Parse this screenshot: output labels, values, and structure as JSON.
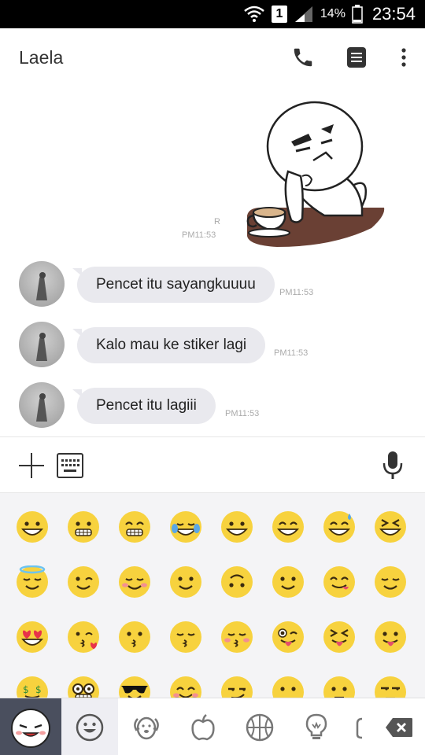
{
  "status_bar": {
    "sim_label": "1",
    "battery_text": "14%",
    "time": "23:54"
  },
  "header": {
    "contact_name": "Laela",
    "icons": [
      "phone-icon",
      "notes-icon",
      "more-vert-icon"
    ]
  },
  "chat": {
    "sent_sticker": {
      "read_mark": "R",
      "time": "PM11:53"
    },
    "messages": [
      {
        "text": "Pencet itu sayangkuuuu",
        "time": "PM11:53"
      },
      {
        "text": "Kalo mau ke stiker lagi",
        "time": "PM11:53"
      },
      {
        "text": "Pencet itu lagiii",
        "time": "PM11:53"
      }
    ]
  },
  "input_bar": {
    "icons": [
      "plus-icon",
      "keyboard-icon",
      "microphone-icon"
    ]
  },
  "emoji_panel": {
    "emoji_names": [
      "grinning-face",
      "grimacing-face",
      "beaming-face",
      "tears-of-joy-face",
      "smiling-face",
      "grinning-smiling-eyes-face",
      "sweat-smile-face",
      "squinting-laugh-face",
      "halo-face",
      "winking-face",
      "blushing-face",
      "slight-smile-face",
      "upside-down-face",
      "smiley-face",
      "yum-face",
      "relieved-face",
      "heart-eyes-face",
      "kissing-heart-face",
      "kissing-face",
      "kissing-closed-eyes-face",
      "kissing-smiling-eyes-face",
      "winking-tongue-face",
      "squinting-tongue-face",
      "tongue-out-face",
      "money-mouth-face",
      "nerd-face",
      "sunglasses-face",
      "hugging-face",
      "smirking-face",
      "no-mouth-face",
      "neutral-face",
      "unamused-face"
    ]
  },
  "tab_bar": {
    "tabs": [
      "recent-sticker",
      "smileys-icon",
      "dog-icon",
      "apple-icon",
      "basketball-icon",
      "lightbulb-icon",
      "symbols-icon",
      "backspace-icon"
    ],
    "active_tab": "smileys-icon"
  }
}
